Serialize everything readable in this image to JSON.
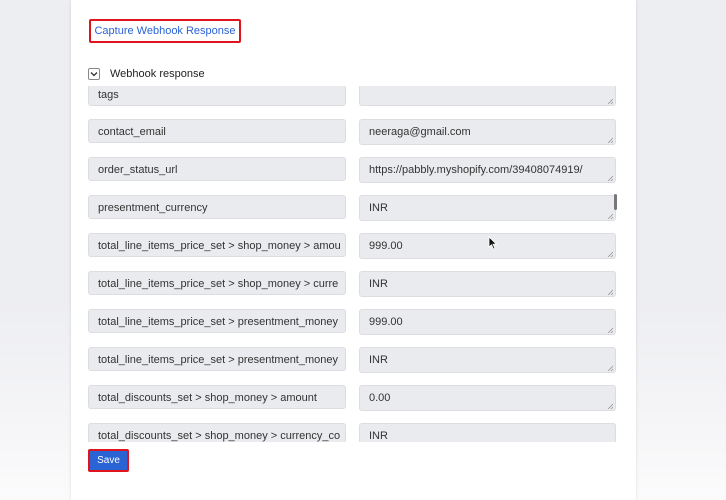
{
  "capture_link": "Capture Webhook Response",
  "section": {
    "title": "Webhook response",
    "expanded": true
  },
  "fields": [
    {
      "key": "tags",
      "value": ""
    },
    {
      "key": "contact_email",
      "value": "neeraga@gmail.com"
    },
    {
      "key": "order_status_url",
      "value": "https://pabbly.myshopify.com/39408074919/"
    },
    {
      "key": "presentment_currency",
      "value": "INR"
    },
    {
      "key": "total_line_items_price_set > shop_money > amou",
      "value": "999.00"
    },
    {
      "key": "total_line_items_price_set > shop_money > curre",
      "value": "INR"
    },
    {
      "key": "total_line_items_price_set > presentment_money",
      "value": "999.00"
    },
    {
      "key": "total_line_items_price_set > presentment_money",
      "value": "INR"
    },
    {
      "key": "total_discounts_set > shop_money > amount",
      "value": "0.00"
    },
    {
      "key": "total_discounts_set > shop_money > currency_co",
      "value": "INR"
    }
  ],
  "save_label": "Save",
  "colors": {
    "accent": "#2a63d4",
    "highlight": "#e0141c",
    "field_bg": "#eaebee"
  }
}
